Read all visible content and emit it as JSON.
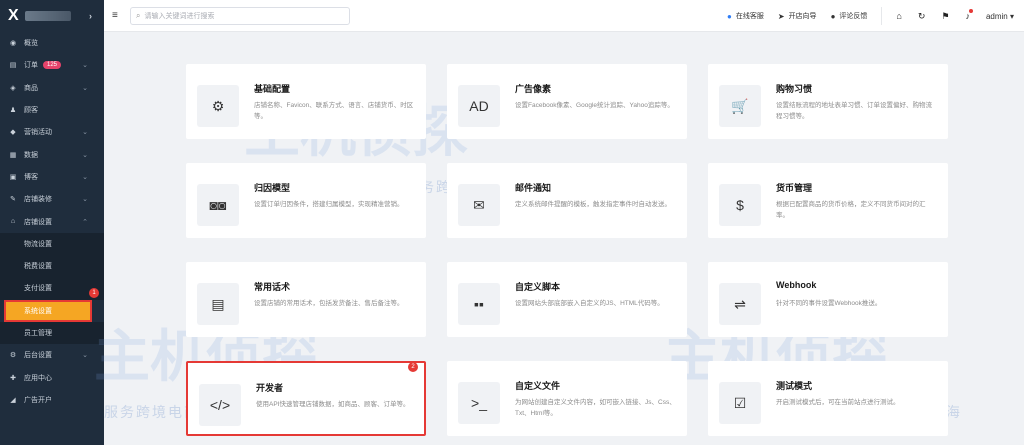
{
  "brand": {
    "logo": "X"
  },
  "nav": {
    "items": [
      {
        "label": "概览",
        "icon": "dashboard-icon",
        "glyph": "◉"
      },
      {
        "label": "订单",
        "icon": "order-icon",
        "glyph": "▤",
        "badge": "125",
        "has_arrow": true
      },
      {
        "label": "商品",
        "icon": "product-icon",
        "glyph": "◈",
        "has_arrow": true
      },
      {
        "label": "顾客",
        "icon": "user-icon",
        "glyph": "♟"
      },
      {
        "label": "营销活动",
        "icon": "tag-icon",
        "glyph": "◆",
        "has_arrow": true
      },
      {
        "label": "数据",
        "icon": "chart-icon",
        "glyph": "▦",
        "has_arrow": true
      },
      {
        "label": "博客",
        "icon": "blog-icon",
        "glyph": "▣",
        "has_arrow": true
      },
      {
        "label": "店铺装修",
        "icon": "paint-icon",
        "glyph": "✎",
        "has_arrow": true
      },
      {
        "label": "店铺设置",
        "icon": "store-icon",
        "glyph": "⌂",
        "has_arrow": true,
        "expanded": true
      }
    ],
    "sub_items": [
      "物流设置",
      "税费设置",
      "支付设置",
      "系统设置",
      "员工管理"
    ],
    "active_sub": "系统设置",
    "bottom_items": [
      {
        "label": "后台设置",
        "icon": "settings-icon",
        "glyph": "⚙",
        "has_arrow": true
      },
      {
        "label": "应用中心",
        "icon": "app-icon",
        "glyph": "✚"
      },
      {
        "label": "广告开户",
        "icon": "megaphone-icon",
        "glyph": "◢"
      }
    ],
    "step_marker": "1"
  },
  "topbar": {
    "search_placeholder": "请输入关键词进行搜索",
    "actions": [
      {
        "label": "在线客服",
        "icon": "support-icon",
        "glyph": "●"
      },
      {
        "label": "开店向导",
        "icon": "send-icon",
        "glyph": "➤"
      },
      {
        "label": "评论反馈",
        "icon": "comment-icon",
        "glyph": "●"
      }
    ],
    "user": "admin ▾"
  },
  "cards": [
    {
      "title": "基础配置",
      "desc": "店铺名称、Favicon、联系方式、语言、店铺货币、时区等。",
      "icon": "gear-icon",
      "glyph": "⚙"
    },
    {
      "title": "广告像素",
      "desc": "设置Facebook像素、Google统计追踪、Yahoo追踪等。",
      "icon": "ad-icon",
      "glyph": "AD"
    },
    {
      "title": "购物习惯",
      "desc": "设置结账流程的地址表单习惯、订单设置偏好、购物流程习惯等。",
      "icon": "cart-icon",
      "glyph": "🛒"
    },
    {
      "title": "归因模型",
      "desc": "设置订单归因条件，搭建归属模型，实现精准营销。",
      "icon": "glasses-icon",
      "glyph": "◙◙"
    },
    {
      "title": "邮件通知",
      "desc": "定义系统邮件提醒的模板，触发指定事件时自动发送。",
      "icon": "mail-icon",
      "glyph": "✉"
    },
    {
      "title": "货币管理",
      "desc": "根据已配置商品的货币价格，定义不同货币间对的汇率。",
      "icon": "dollar-icon",
      "glyph": "$"
    },
    {
      "title": "常用话术",
      "desc": "设置店铺的常用话术，包括发货备注、售后备注等。",
      "icon": "chat-icon",
      "glyph": "▤"
    },
    {
      "title": "自定义脚本",
      "desc": "设置网站头部底部嵌入自定义的JS、HTML代码等。",
      "icon": "blocks-icon",
      "glyph": "▪▪"
    },
    {
      "title": "Webhook",
      "desc": "针对不同的事件设置Webhook推送。",
      "icon": "toggle-icon",
      "glyph": "⇌"
    },
    {
      "title": "开发者",
      "desc": "使用API快速管理店铺数据，如商品、顾客、订单等。",
      "icon": "code-icon",
      "glyph": "</>"
    },
    {
      "title": "自定义文件",
      "desc": "为网站创建自定义文件内容，如可嵌入链接、Js、Css、Txt、Html等。",
      "icon": "terminal-icon",
      "glyph": ">_"
    },
    {
      "title": "测试模式",
      "desc": "开启测试模式后，可在当前站点进行测试。",
      "icon": "checklist-icon",
      "glyph": "☑"
    }
  ],
  "card_marker": "2",
  "watermark": {
    "text": "服务跨境电商 助力中企出海",
    "brand": "主机侦探"
  }
}
